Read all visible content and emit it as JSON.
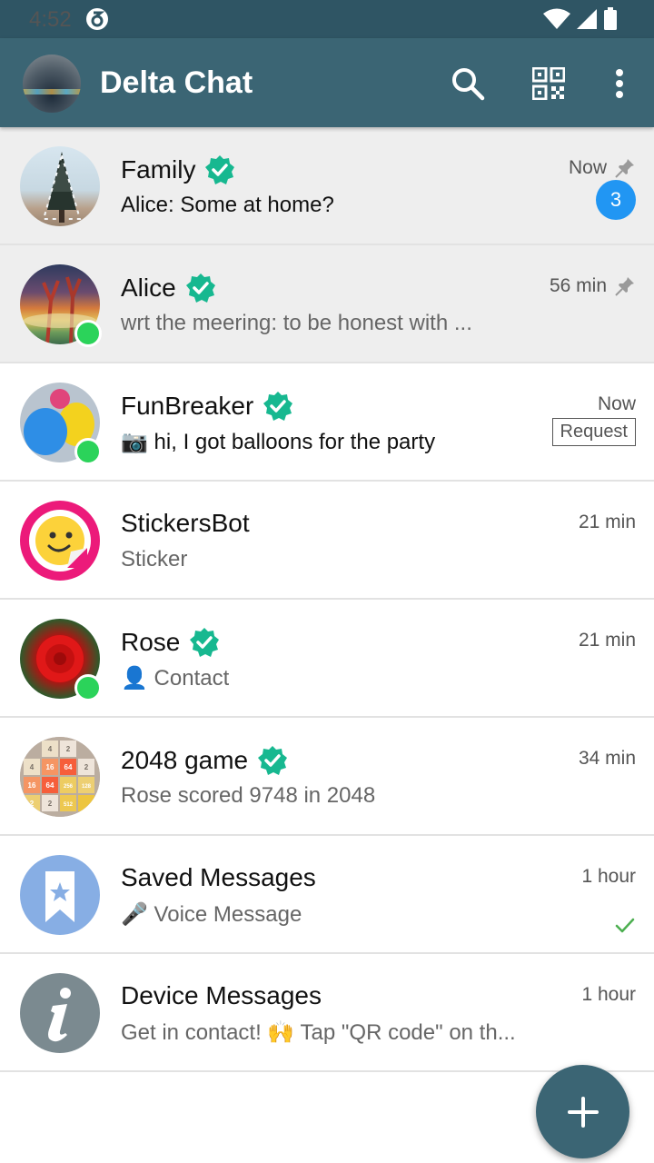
{
  "status_bar": {
    "time": "4:52"
  },
  "app_bar": {
    "title": "Delta Chat"
  },
  "chats": [
    {
      "name": "Family",
      "preview": "Alice: Some at home?",
      "time": "Now",
      "unread": "3"
    },
    {
      "name": "Alice",
      "preview": "wrt the meering: to be honest with ...",
      "time": "56 min"
    },
    {
      "name": "FunBreaker",
      "preview": "📷 hi, I got balloons for the party",
      "time": "Now",
      "request_label": "Request"
    },
    {
      "name": "StickersBot",
      "preview": "Sticker",
      "time": "21 min"
    },
    {
      "name": "Rose",
      "preview": "👤 Contact",
      "time": "21 min"
    },
    {
      "name": "2048 game",
      "preview": "Rose scored 9748 in 2048",
      "time": "34 min"
    },
    {
      "name": "Saved Messages",
      "preview": "🎤 Voice Message",
      "time": "1 hour"
    },
    {
      "name": "Device Messages",
      "preview": "Get in contact! 🙌 Tap \"QR code\" on th...",
      "time": "1 hour"
    }
  ],
  "game_tiles": [
    "4",
    "2",
    "4",
    "16",
    "64",
    "2",
    "16",
    "64",
    "256",
    "128",
    "2",
    "512",
    "2"
  ],
  "colors": {
    "appbar": "#3b6574",
    "statusbar": "#2f5564",
    "verified": "#17b890",
    "badge": "#2196f3",
    "online": "#2bd35a"
  }
}
